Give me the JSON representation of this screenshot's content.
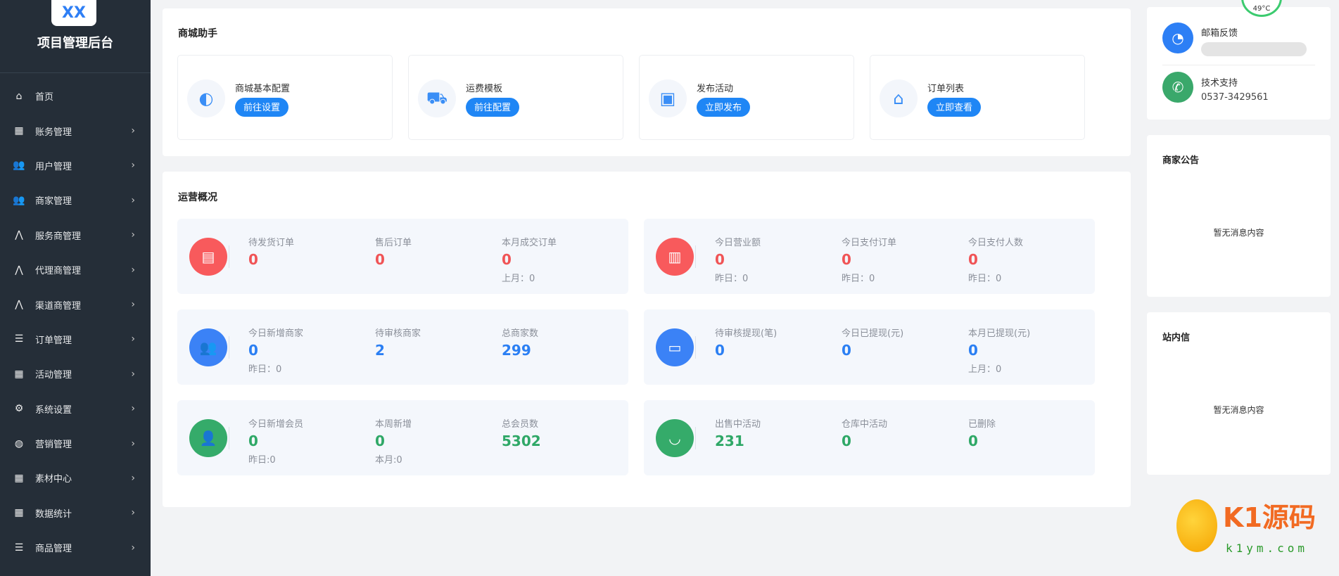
{
  "sidebar": {
    "logo": "XX",
    "title": "项目管理后台",
    "items": [
      {
        "label": "首页",
        "icon": "home-icon",
        "glyph": "⌂",
        "chevron": false
      },
      {
        "label": "账务管理",
        "icon": "money-icon",
        "glyph": "▦",
        "chevron": true
      },
      {
        "label": "用户管理",
        "icon": "users-icon",
        "glyph": "👥",
        "chevron": true
      },
      {
        "label": "商家管理",
        "icon": "merchants-icon",
        "glyph": "👥",
        "chevron": true
      },
      {
        "label": "服务商管理",
        "icon": "network-icon",
        "glyph": "⋀",
        "chevron": true
      },
      {
        "label": "代理商管理",
        "icon": "network-icon",
        "glyph": "⋀",
        "chevron": true
      },
      {
        "label": "渠道商管理",
        "icon": "network-icon",
        "glyph": "⋀",
        "chevron": true
      },
      {
        "label": "订单管理",
        "icon": "list-icon",
        "glyph": "☰",
        "chevron": true
      },
      {
        "label": "活动管理",
        "icon": "grid-icon",
        "glyph": "▦",
        "chevron": true
      },
      {
        "label": "系统设置",
        "icon": "gear-icon",
        "glyph": "⚙",
        "chevron": true
      },
      {
        "label": "营销管理",
        "icon": "globe-icon",
        "glyph": "◍",
        "chevron": true
      },
      {
        "label": "素材中心",
        "icon": "grid-icon",
        "glyph": "▦",
        "chevron": true
      },
      {
        "label": "数据统计",
        "icon": "grid-icon",
        "glyph": "▦",
        "chevron": true
      },
      {
        "label": "商品管理",
        "icon": "list-icon",
        "glyph": "☰",
        "chevron": true
      }
    ]
  },
  "assistant": {
    "title": "商城助手",
    "cards": [
      {
        "label": "商城基本配置",
        "button": "前往设置",
        "icon": "palette-icon",
        "glyph": "◐"
      },
      {
        "label": "运费模板",
        "button": "前往配置",
        "icon": "truck-icon",
        "glyph": "⛟"
      },
      {
        "label": "发布活动",
        "button": "立即发布",
        "icon": "bag-icon",
        "glyph": "▣"
      },
      {
        "label": "订单列表",
        "button": "立即查看",
        "icon": "store-icon",
        "glyph": "⌂"
      }
    ]
  },
  "overview": {
    "title": "运营概况",
    "boxes": [
      {
        "color": "red",
        "bg": "#f85a5c",
        "icon": "document-icon",
        "glyph": "▤",
        "cols": [
          {
            "label": "待发货订单",
            "value": "0",
            "sub": ""
          },
          {
            "label": "售后订单",
            "value": "0",
            "sub": ""
          },
          {
            "label": "本月成交订单",
            "value": "0",
            "sub": "上月：0"
          }
        ]
      },
      {
        "color": "red",
        "bg": "#f85a5c",
        "icon": "bar-chart-icon",
        "glyph": "▥",
        "cols": [
          {
            "label": "今日营业额",
            "value": "0",
            "sub": "昨日：0"
          },
          {
            "label": "今日支付订单",
            "value": "0",
            "sub": "昨日：0"
          },
          {
            "label": "今日支付人数",
            "value": "0",
            "sub": "昨日：0"
          }
        ]
      },
      {
        "color": "blue",
        "bg": "#3b82f6",
        "icon": "users-icon",
        "glyph": "👥",
        "cols": [
          {
            "label": "今日新增商家",
            "value": "0",
            "sub": "昨日：0"
          },
          {
            "label": "待审核商家",
            "value": "2",
            "sub": ""
          },
          {
            "label": "总商家数",
            "value": "299",
            "sub": ""
          }
        ]
      },
      {
        "color": "blue",
        "bg": "#3b82f6",
        "icon": "wallet-icon",
        "glyph": "▭",
        "cols": [
          {
            "label": "待审核提现(笔)",
            "value": "0",
            "sub": ""
          },
          {
            "label": "今日已提现(元)",
            "value": "0",
            "sub": ""
          },
          {
            "label": "本月已提现(元)",
            "value": "0",
            "sub": "上月：0"
          }
        ]
      },
      {
        "color": "green",
        "bg": "#35ab6a",
        "icon": "member-icon",
        "glyph": "👤",
        "cols": [
          {
            "label": "今日新增会员",
            "value": "0",
            "sub": "昨日:0"
          },
          {
            "label": "本周新增",
            "value": "0",
            "sub": "本月:0"
          },
          {
            "label": "总会员数",
            "value": "5302",
            "sub": ""
          }
        ]
      },
      {
        "color": "green",
        "bg": "#35ab6a",
        "icon": "shopping-bag-icon",
        "glyph": "◡",
        "cols": [
          {
            "label": "出售中活动",
            "value": "231",
            "sub": ""
          },
          {
            "label": "仓库中活动",
            "value": "0",
            "sub": ""
          },
          {
            "label": "已删除",
            "value": "0",
            "sub": ""
          }
        ]
      }
    ]
  },
  "contact": {
    "email_label": "邮箱反馈",
    "support_label": "技术支持",
    "phone": "0537-3429561"
  },
  "notice": {
    "title": "商家公告",
    "empty": "暂无消息内容"
  },
  "inbox": {
    "title": "站内信",
    "empty": "暂无消息内容"
  },
  "widget": {
    "temp": "49°C"
  },
  "watermark": {
    "text": "K1源码",
    "url": "k1ym.com"
  }
}
